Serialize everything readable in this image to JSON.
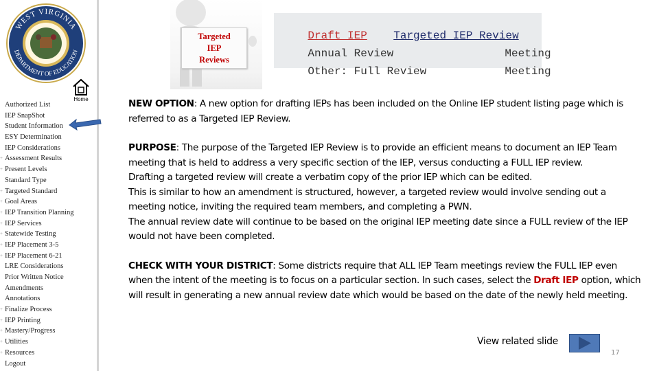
{
  "sidebar": {
    "logo_alt": "West Virginia Department of Education seal",
    "home_label": "Home",
    "items": [
      {
        "label": "Authorized List",
        "expandable": false
      },
      {
        "label": "IEP SnapShot",
        "expandable": false
      },
      {
        "label": "Student Information",
        "expandable": false
      },
      {
        "label": "ESY Determination",
        "expandable": false
      },
      {
        "label": "IEP Considerations",
        "expandable": false
      },
      {
        "label": "Assessment Results",
        "expandable": true
      },
      {
        "label": "Present Levels",
        "expandable": true
      },
      {
        "label": "Standard Type",
        "expandable": false
      },
      {
        "label": "Targeted Standard",
        "expandable": true
      },
      {
        "label": "Goal Areas",
        "expandable": true
      },
      {
        "label": "IEP Transition Planning",
        "expandable": true
      },
      {
        "label": "IEP Services",
        "expandable": true
      },
      {
        "label": "Statewide Testing",
        "expandable": true
      },
      {
        "label": "IEP Placement 3-5",
        "expandable": true
      },
      {
        "label": "IEP Placement 6-21",
        "expandable": true
      },
      {
        "label": "LRE Considerations",
        "expandable": false
      },
      {
        "label": "Prior Written Notice",
        "expandable": false
      },
      {
        "label": "Amendments",
        "expandable": false
      },
      {
        "label": "Annotations",
        "expandable": false
      },
      {
        "label": "Finalize Process",
        "expandable": true
      },
      {
        "label": "IEP Printing",
        "expandable": true
      },
      {
        "label": "Mastery/Progress",
        "expandable": true
      },
      {
        "label": "Utilities",
        "expandable": true
      },
      {
        "label": "Resources",
        "expandable": true
      },
      {
        "label": "Logout",
        "expandable": false
      }
    ]
  },
  "figure": {
    "sign_lines": [
      "Targeted",
      "IEP",
      "Reviews"
    ]
  },
  "listing": {
    "draft_iep": "Draft IEP",
    "targeted_review": "Targeted IEP Review",
    "row2_left": "Annual Review",
    "row2_right": "Meeting",
    "row3_left": "Other: Full Review",
    "row3_right": "Meeting"
  },
  "content": {
    "new_option_label": "NEW OPTION",
    "new_option_text": ":  A new option for drafting IEPs has been included on the Online IEP student listing page which is referred to as a Targeted IEP Review.",
    "purpose_label": "PURPOSE",
    "purpose_text": ":  The purpose of the Targeted IEP Review is to provide an efficient means to document an IEP Team meeting that is held to address a very specific section of the IEP, versus conducting a FULL IEP review.",
    "purpose_line2": "Drafting a targeted review will create a verbatim copy of the prior IEP which can be edited.",
    "purpose_line3": "This is similar to how an amendment is structured, however, a targeted review would involve sending out a meeting notice, inviting the required team members, and completing a PWN.",
    "purpose_line4": "The annual review date will continue to be based on the original IEP meeting date since a FULL review of the IEP would not have been completed.",
    "check_label": "CHECK WITH YOUR DISTRICT",
    "check_text": ": Some districts require that ALL IEP Team meetings review the FULL IEP even when the intent of the meeting is to focus on a particular section.  In such cases, select the ",
    "check_highlight": "Draft IEP",
    "check_text2": " option, which will result in generating a new annual review date which would be based on the date of the newly held meeting."
  },
  "footer": {
    "related_label": "View related slide",
    "page_number": "17"
  },
  "colors": {
    "accent_red": "#c00000",
    "button_blue": "#4f79b8",
    "arrow_blue": "#3a68b0"
  }
}
